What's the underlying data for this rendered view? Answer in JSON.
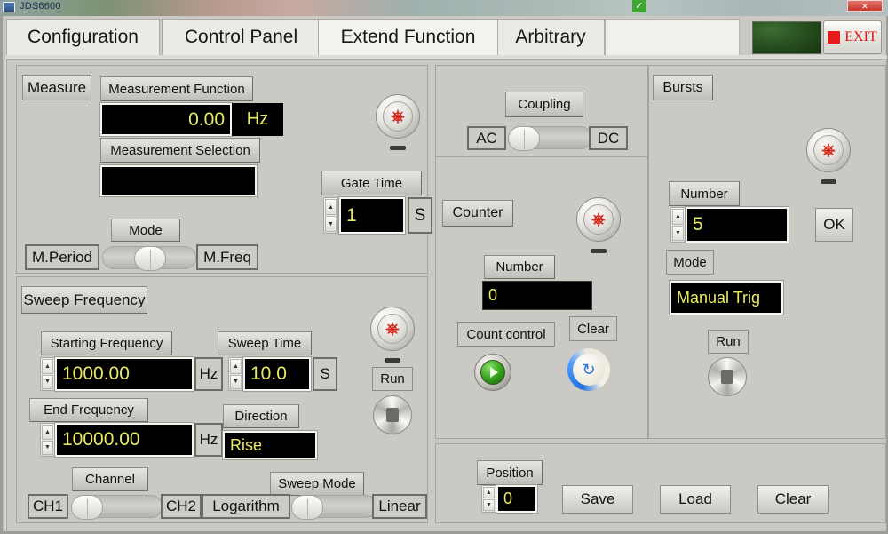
{
  "desktop": {
    "app_title": "JDS6600",
    "icon": "monitor-icon",
    "check_icon": "✓",
    "close_icon": "✕"
  },
  "tabs": [
    {
      "label": "Configuration",
      "selected": false
    },
    {
      "label": "Control Panel",
      "selected": false
    },
    {
      "label": "Extend Function",
      "selected": true
    },
    {
      "label": "Arbitrary",
      "selected": false
    }
  ],
  "toolbar": {
    "indicator_name": "green-status-panel",
    "exit_label": "EXIT"
  },
  "measure": {
    "title": "Measure",
    "function_label": "Measurement Function",
    "function_value": "0.00",
    "function_unit": "Hz",
    "selection_label": "Measurement Selection",
    "selection_value": "",
    "mode_label": "Mode",
    "mode_left": "M.Period",
    "mode_right": "M.Freq",
    "power_name": "measure-power-button",
    "gate_time_label": "Gate Time",
    "gate_time_value": "1",
    "gate_time_unit": "S"
  },
  "sweep": {
    "title": "Sweep Frequency",
    "start_label": "Starting Frequency",
    "start_value": "1000.00",
    "start_unit": "Hz",
    "end_label": "End Frequency",
    "end_value": "10000.00",
    "end_unit": "Hz",
    "time_label": "Sweep Time",
    "time_value": "10.0",
    "time_unit": "S",
    "direction_label": "Direction",
    "direction_value": "Rise",
    "channel_label": "Channel",
    "channel_left": "CH1",
    "channel_right": "CH2",
    "mode_label": "Sweep Mode",
    "mode_left": "Logarithm",
    "mode_right": "Linear",
    "run_label": "Run",
    "power_name": "sweep-power-button"
  },
  "coupling": {
    "title": "Coupling",
    "left": "AC",
    "right": "DC"
  },
  "counter": {
    "title": "Counter",
    "number_label": "Number",
    "number_value": "0",
    "count_control_label": "Count control",
    "clear_label": "Clear",
    "power_name": "counter-power-button"
  },
  "bursts": {
    "title": "Bursts",
    "number_label": "Number",
    "number_value": "5",
    "mode_label": "Mode",
    "mode_value": "Manual Trig",
    "run_label": "Run",
    "ok_label": "OK",
    "power_name": "bursts-power-button"
  },
  "bottom": {
    "position_label": "Position",
    "position_value": "0",
    "save_label": "Save",
    "load_label": "Load",
    "clear_label": "Clear"
  },
  "colors": {
    "panel_bg": "#cbc9c4",
    "display_bg": "#000000",
    "display_text": "#e9ea63",
    "exit_red": "#e01616",
    "indicator_green": "#2a5222"
  }
}
